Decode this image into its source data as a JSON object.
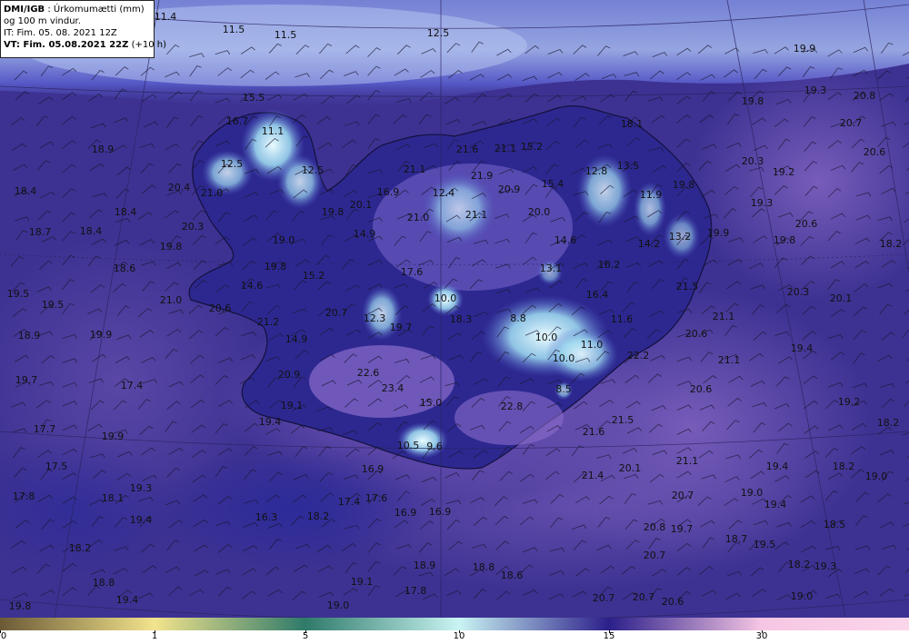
{
  "header": {
    "source": "DMI/IGB",
    "title": "Úrkomumætti (mm)",
    "subtitle": "og 100 m vindur.",
    "issue_time": "IT: Fim. 05. 08. 2021 12Z",
    "valid_prefix": "VT: Fim. 05.08.2021 22Z",
    "valid_suffix": "(+10 h)"
  },
  "colorbar": {
    "tick_labels": [
      "0",
      "1",
      "5",
      "10",
      "15",
      "30"
    ],
    "stops": [
      {
        "value_label": "0",
        "color": "#6b5a36"
      },
      {
        "value_label": "1",
        "color": "#f2e38c"
      },
      {
        "value_label": "5",
        "color": "#2f7a6a"
      },
      {
        "value_label": "10",
        "color": "#c9f4f3"
      },
      {
        "value_label": "15",
        "color": "#2b1f8a"
      },
      {
        "value_label": "30",
        "color": "#f6c6e4"
      }
    ]
  },
  "map_labels": [
    {
      "text": "11.4"
    },
    {
      "text": "11.5"
    },
    {
      "text": "11.5"
    },
    {
      "text": "12.5"
    },
    {
      "text": "19.9"
    },
    {
      "text": "19.3"
    },
    {
      "text": "20.8"
    },
    {
      "text": "19.8"
    },
    {
      "text": "20.7"
    },
    {
      "text": "15.5"
    },
    {
      "text": "16.7"
    },
    {
      "text": "11.1"
    },
    {
      "text": "18.1"
    },
    {
      "text": "20.6"
    },
    {
      "text": "18.9"
    },
    {
      "text": "21.6"
    },
    {
      "text": "21.1"
    },
    {
      "text": "15.2"
    },
    {
      "text": "12.5"
    },
    {
      "text": "12.5"
    },
    {
      "text": "21.1"
    },
    {
      "text": "21.9"
    },
    {
      "text": "12.8"
    },
    {
      "text": "13.5"
    },
    {
      "text": "20.3"
    },
    {
      "text": "19.2"
    },
    {
      "text": "18.4"
    },
    {
      "text": "20.4"
    },
    {
      "text": "21.0"
    },
    {
      "text": "16.9"
    },
    {
      "text": "12.4"
    },
    {
      "text": "20.9"
    },
    {
      "text": "15.4"
    },
    {
      "text": "11.9"
    },
    {
      "text": "19.8"
    },
    {
      "text": "19.3"
    },
    {
      "text": "18.4"
    },
    {
      "text": "19.8"
    },
    {
      "text": "20.1"
    },
    {
      "text": "21.0"
    },
    {
      "text": "21.1"
    },
    {
      "text": "20.0"
    },
    {
      "text": "20.6"
    },
    {
      "text": "18.7"
    },
    {
      "text": "18.4"
    },
    {
      "text": "20.3"
    },
    {
      "text": "14.9"
    },
    {
      "text": "13.2"
    },
    {
      "text": "19.9"
    },
    {
      "text": "19.8"
    },
    {
      "text": "19.8"
    },
    {
      "text": "19.0"
    },
    {
      "text": "14.6"
    },
    {
      "text": "14.2"
    },
    {
      "text": "18.2"
    },
    {
      "text": "18.6"
    },
    {
      "text": "19.8"
    },
    {
      "text": "13.1"
    },
    {
      "text": "16.2"
    },
    {
      "text": "15.2"
    },
    {
      "text": "17.6"
    },
    {
      "text": "19.5"
    },
    {
      "text": "21.0"
    },
    {
      "text": "14.6"
    },
    {
      "text": "10.0"
    },
    {
      "text": "16.4"
    },
    {
      "text": "21.5"
    },
    {
      "text": "20.3"
    },
    {
      "text": "20.1"
    },
    {
      "text": "19.5"
    },
    {
      "text": "20.6"
    },
    {
      "text": "20.7"
    },
    {
      "text": "12.3"
    },
    {
      "text": "18.3"
    },
    {
      "text": "8.8"
    },
    {
      "text": "11.6"
    },
    {
      "text": "21.1"
    },
    {
      "text": "21.2"
    },
    {
      "text": "19.7"
    },
    {
      "text": "10.0"
    },
    {
      "text": "20.6"
    },
    {
      "text": "18.9"
    },
    {
      "text": "19.9"
    },
    {
      "text": "14.9"
    },
    {
      "text": "11.0"
    },
    {
      "text": "19.4"
    },
    {
      "text": "22.2"
    },
    {
      "text": "21.1"
    },
    {
      "text": "10.0"
    },
    {
      "text": "20.9"
    },
    {
      "text": "22.6"
    },
    {
      "text": "19.7"
    },
    {
      "text": "17.4"
    },
    {
      "text": "23.4"
    },
    {
      "text": "8.5"
    },
    {
      "text": "20.6"
    },
    {
      "text": "19.1"
    },
    {
      "text": "15.0"
    },
    {
      "text": "22.8"
    },
    {
      "text": "19.2"
    },
    {
      "text": "19.4"
    },
    {
      "text": "21.5"
    },
    {
      "text": "18.2"
    },
    {
      "text": "17.7"
    },
    {
      "text": "19.9"
    },
    {
      "text": "21.6"
    },
    {
      "text": "10.5"
    },
    {
      "text": "9.6"
    },
    {
      "text": "17.5"
    },
    {
      "text": "16.9"
    },
    {
      "text": "21.1"
    },
    {
      "text": "19.4"
    },
    {
      "text": "18.2"
    },
    {
      "text": "20.1"
    },
    {
      "text": "21.4"
    },
    {
      "text": "19.0"
    },
    {
      "text": "17.8"
    },
    {
      "text": "18.1"
    },
    {
      "text": "19.3"
    },
    {
      "text": "17.4"
    },
    {
      "text": "17.6"
    },
    {
      "text": "20.7"
    },
    {
      "text": "19.0"
    },
    {
      "text": "19.4"
    },
    {
      "text": "19.4"
    },
    {
      "text": "16.3"
    },
    {
      "text": "18.2"
    },
    {
      "text": "16.9"
    },
    {
      "text": "16.9"
    },
    {
      "text": "18.5"
    },
    {
      "text": "20.8"
    },
    {
      "text": "19.7"
    },
    {
      "text": "18.2"
    },
    {
      "text": "18.7"
    },
    {
      "text": "19.5"
    },
    {
      "text": "20.7"
    },
    {
      "text": "18.2"
    },
    {
      "text": "18.9"
    },
    {
      "text": "18.8"
    },
    {
      "text": "19.1"
    },
    {
      "text": "19.3"
    },
    {
      "text": "18.8"
    },
    {
      "text": "18.6"
    },
    {
      "text": "17.8"
    },
    {
      "text": "19.4"
    },
    {
      "text": "20.7"
    },
    {
      "text": "20.7"
    },
    {
      "text": "20.6"
    },
    {
      "text": "19.0"
    },
    {
      "text": "19.8"
    },
    {
      "text": "19.0"
    }
  ]
}
